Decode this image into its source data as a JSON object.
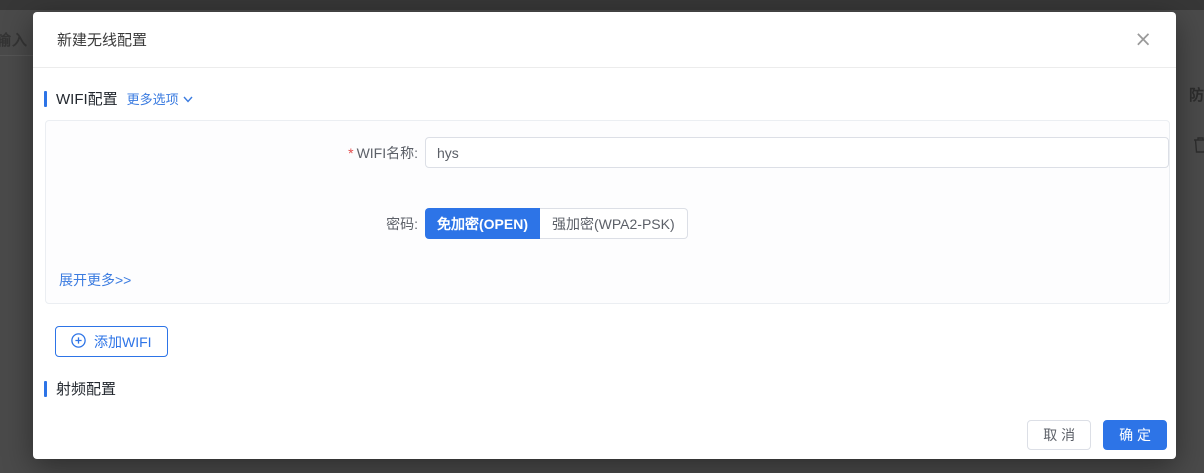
{
  "background": {
    "left_partial_text": "输入",
    "right_partial_text": "防"
  },
  "modal": {
    "title": "新建无线配置",
    "close": "×",
    "wifi_section": {
      "title": "WIFI配置",
      "more_options": "更多选项"
    },
    "form": {
      "required_mark": "*",
      "wifi_name_label": "WIFI名称:",
      "wifi_name_value": "hys",
      "password_label": "密码:",
      "password_options": [
        {
          "label": "免加密(OPEN)",
          "selected": true
        },
        {
          "label": "强加密(WPA2-PSK)",
          "selected": false
        }
      ],
      "expand_more": "展开更多>>"
    },
    "add_wifi_label": "添加WIFI",
    "radio_section": {
      "title": "射频配置"
    },
    "footer": {
      "cancel": "取 消",
      "confirm": "确 定"
    }
  },
  "colors": {
    "accent": "#2d74e7",
    "link": "#3a7be0",
    "overlay": "#4a4a4a"
  }
}
